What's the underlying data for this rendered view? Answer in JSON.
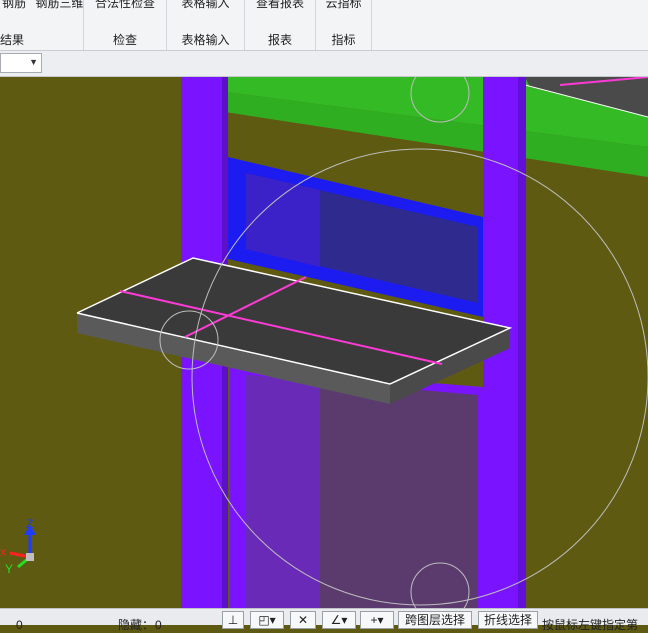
{
  "ribbon": {
    "groups": [
      {
        "items": [
          "钢筋",
          "钢筋三维"
        ],
        "label": "结果"
      },
      {
        "items": [
          "合法性检查"
        ],
        "label": "检查"
      },
      {
        "items": [
          "表格输入"
        ],
        "label": "表格输入"
      },
      {
        "items": [
          "查看报表"
        ],
        "label": "报表"
      },
      {
        "items": [
          "云指标"
        ],
        "label": "指标"
      }
    ]
  },
  "toolbar": {
    "dropdown_value": ""
  },
  "axes": {
    "z": "Z",
    "y": "Y",
    "x": "X"
  },
  "status": {
    "value_left": "0",
    "hidden_label": "隐藏：",
    "hidden_value": "0",
    "btn_cross_layer": "跨图层选择",
    "btn_polyline": "折线选择",
    "hint": "按鼠标左键指定第"
  },
  "colors": {
    "background": "#5f5a12",
    "column": "#7a13ff",
    "slab": "#33ba25",
    "window_frame": "#1c1cf0",
    "canopy_top": "#3a3a3a",
    "canopy_side": "#5a5a5a",
    "rebar_line": "#ff3ad6"
  }
}
